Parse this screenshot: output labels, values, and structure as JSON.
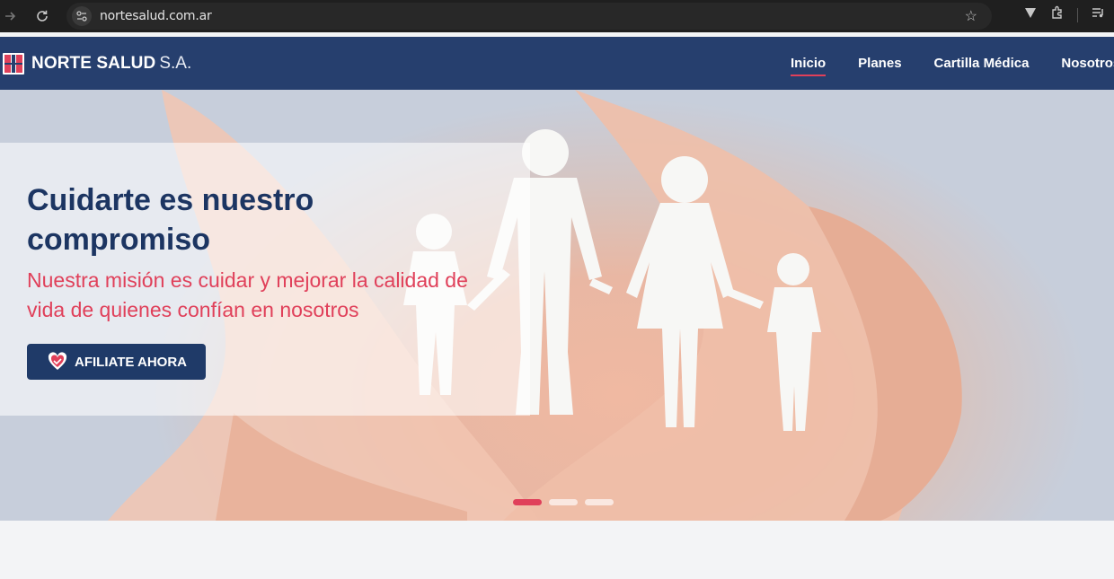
{
  "browser": {
    "url": "nortesalud.com.ar",
    "icons": [
      "back-arrow-icon",
      "reload-icon",
      "site-info-icon",
      "star-icon",
      "vpn-icon",
      "extensions-icon",
      "media-icon"
    ]
  },
  "site": {
    "brand": "NORTE SALUD",
    "brand_suffix": "S.A.",
    "nav": [
      {
        "label": "Inicio",
        "active": true
      },
      {
        "label": "Planes"
      },
      {
        "label": "Cartilla Médica"
      },
      {
        "label": "Nosotros"
      }
    ]
  },
  "hero": {
    "title": "Cuidarte es nuestro compromiso",
    "subtitle": "Nuestra misión es cuidar y mejorar la calidad de vida de quienes confían en nosotros",
    "cta_label": "AFILIATE AHORA",
    "slides": 3,
    "active_slide": 1
  },
  "colors": {
    "navy": "#263f6e",
    "accent": "#e0405a",
    "title": "#1c3562"
  }
}
